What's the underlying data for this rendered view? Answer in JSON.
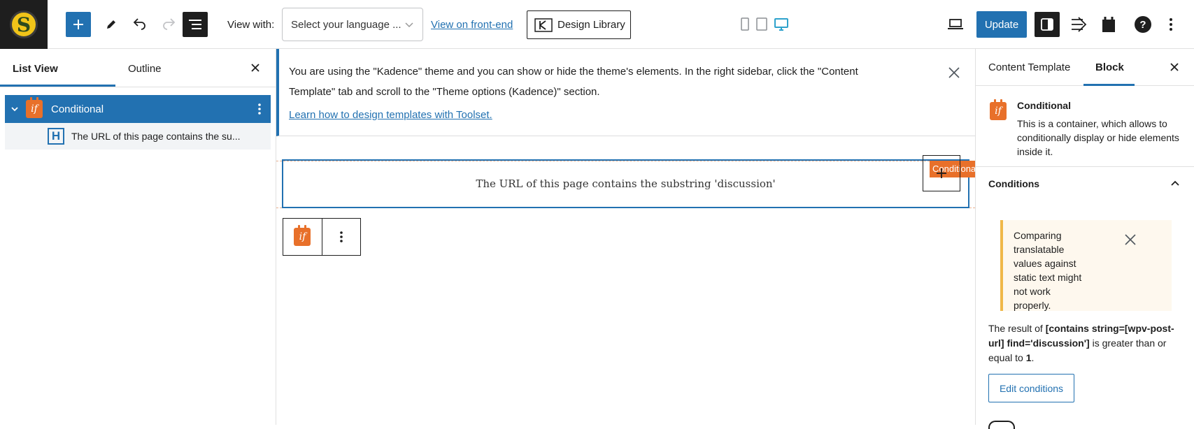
{
  "toolbar": {
    "logo_letter": "S",
    "view_with_label": "View with:",
    "language_placeholder": "Select your language ...",
    "front_end_link": "View on front-end",
    "design_library_label": "Design Library",
    "update_label": "Update",
    "accent_color": "#2271b1"
  },
  "left_panel": {
    "tabs": [
      {
        "label": "List View",
        "active": true
      },
      {
        "label": "Outline",
        "active": false
      }
    ],
    "items": [
      {
        "label": "Conditional",
        "icon": "conditional-icon",
        "selected": true
      },
      {
        "label": "The URL of this page contains the su...",
        "icon": "heading-icon",
        "selected": false
      }
    ]
  },
  "notice": {
    "text": "You are using the \"Kadence\" theme and you can show or hide the theme's elements. In the right sidebar, click the \"Content Template\" tab and scroll to the \"Theme options (Kadence)\" section.",
    "link": "Learn how to design templates with Toolset."
  },
  "canvas": {
    "block_text": "The URL of this page contains the substring 'discussion'",
    "block_tag": "Conditional",
    "tag_color": "#e8702a"
  },
  "right_panel": {
    "tabs": [
      {
        "label": "Content Template",
        "active": false
      },
      {
        "label": "Block",
        "active": true
      }
    ],
    "block_title": "Conditional",
    "block_description": "This is a container, which allows to conditionally display or hide elements inside it.",
    "conditions_title": "Conditions",
    "warning_text": "Comparing translatable values against static text might not work properly.",
    "result_prefix": "The result of ",
    "result_expression": "[contains string=[wpv-post-url] find='discussion']",
    "result_middle": " is greater than or equal to ",
    "result_value": "1",
    "result_suffix": ".",
    "edit_button": "Edit conditions"
  }
}
